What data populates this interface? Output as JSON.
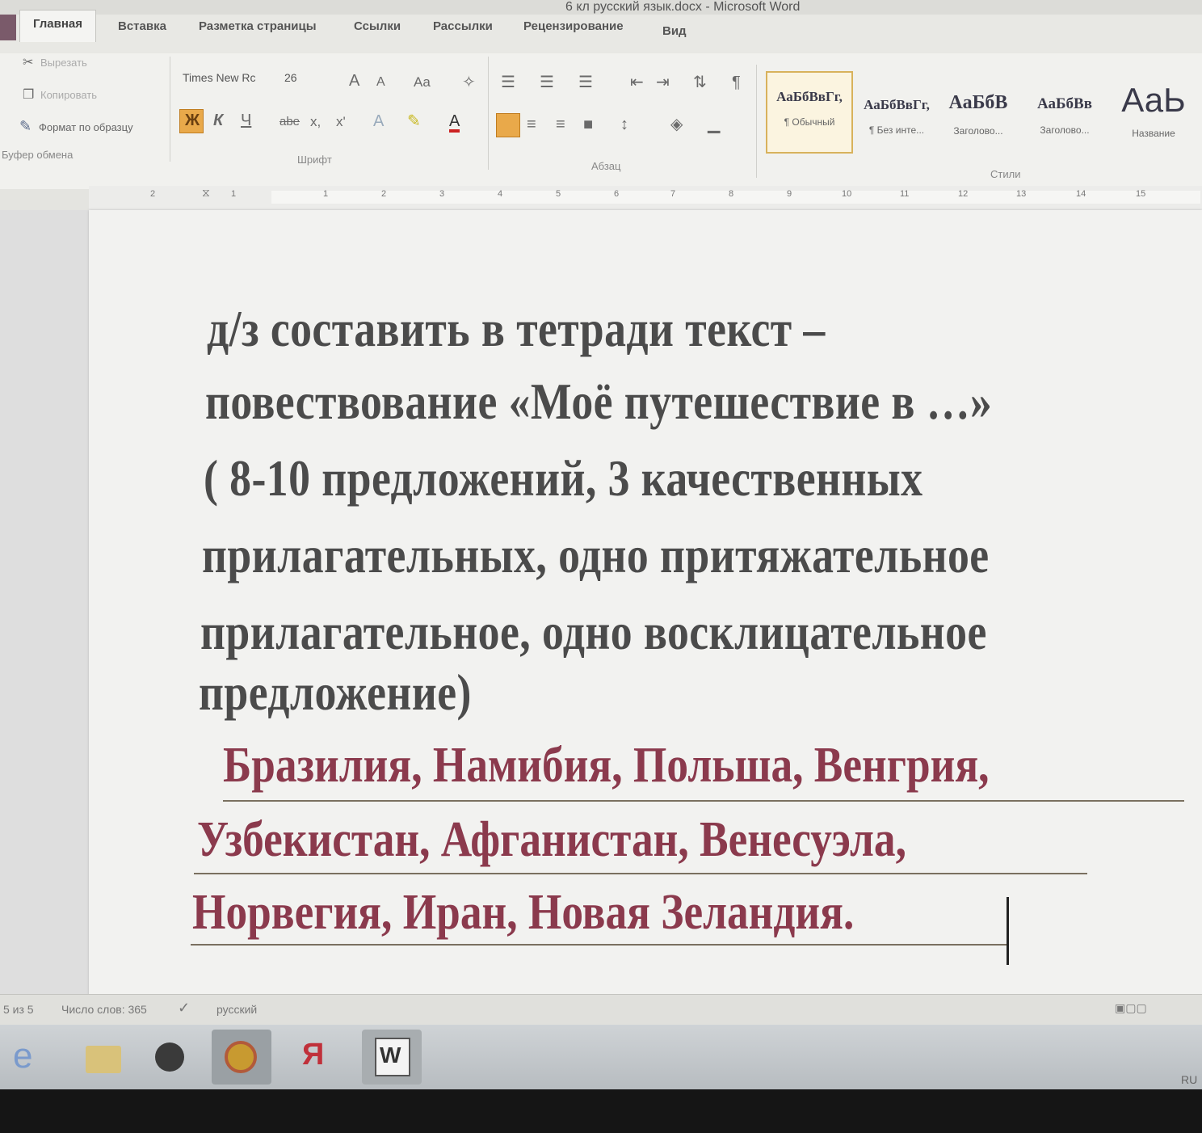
{
  "window": {
    "title": "6 кл русский язык.docx - Microsoft Word"
  },
  "tabs": [
    {
      "label": "Главная"
    },
    {
      "label": "Вставка"
    },
    {
      "label": "Разметка страницы"
    },
    {
      "label": "Ссылки"
    },
    {
      "label": "Рассылки"
    },
    {
      "label": "Рецензирование"
    },
    {
      "label": "Вид"
    }
  ],
  "clipboard": {
    "cut": "Вырезать",
    "copy": "Копировать",
    "format_painter": "Формат по образцу",
    "group": "Буфер обмена"
  },
  "font": {
    "name": "Times New Rc",
    "size": "26",
    "group": "Шрифт",
    "bold": "Ж",
    "italic": "К",
    "underline": "Ч",
    "strike": "abe",
    "subscript": "x,",
    "superscript": "x'"
  },
  "paragraph": {
    "group": "Абзац",
    "pilcrow": "¶"
  },
  "styles": {
    "group": "Стили",
    "items": [
      {
        "preview": "АаБбВвГг,",
        "name": "¶ Обычный"
      },
      {
        "preview": "АаБбВвГг,",
        "name": "¶ Без инте..."
      },
      {
        "preview": "АаБбВ",
        "name": "Заголово..."
      },
      {
        "preview": "АаБбВв",
        "name": "Заголово..."
      },
      {
        "preview": "АаЬ",
        "name": "Название"
      }
    ]
  },
  "ruler": {
    "numbers": [
      "2",
      "1",
      "1",
      "2",
      "3",
      "4",
      "5",
      "6",
      "7",
      "8",
      "9",
      "10",
      "11",
      "12",
      "13",
      "14",
      "15"
    ]
  },
  "document": {
    "lines": [
      "д/з составить в тетради текст –",
      "повествование «Моё путешествие в …»",
      "( 8-10 предложений, 3 качественных",
      "прилагательных, одно притяжательное",
      "прилагательное, одно восклицательное",
      "предложение)"
    ],
    "countries": [
      "Бразилия, Намибия, Польша, Венгрия,",
      "Узбекистан, Афганистан, Венесуэла,",
      "Норвегия, Иран, Новая Зеландия."
    ],
    "text_color": "#4b4b4b",
    "countries_color": "#8b3a4d"
  },
  "status": {
    "page": "5 из 5",
    "words": "Число слов: 365",
    "language": "русский"
  },
  "taskbar": {
    "yandex": "Я",
    "word": "W",
    "lang": "RU"
  }
}
